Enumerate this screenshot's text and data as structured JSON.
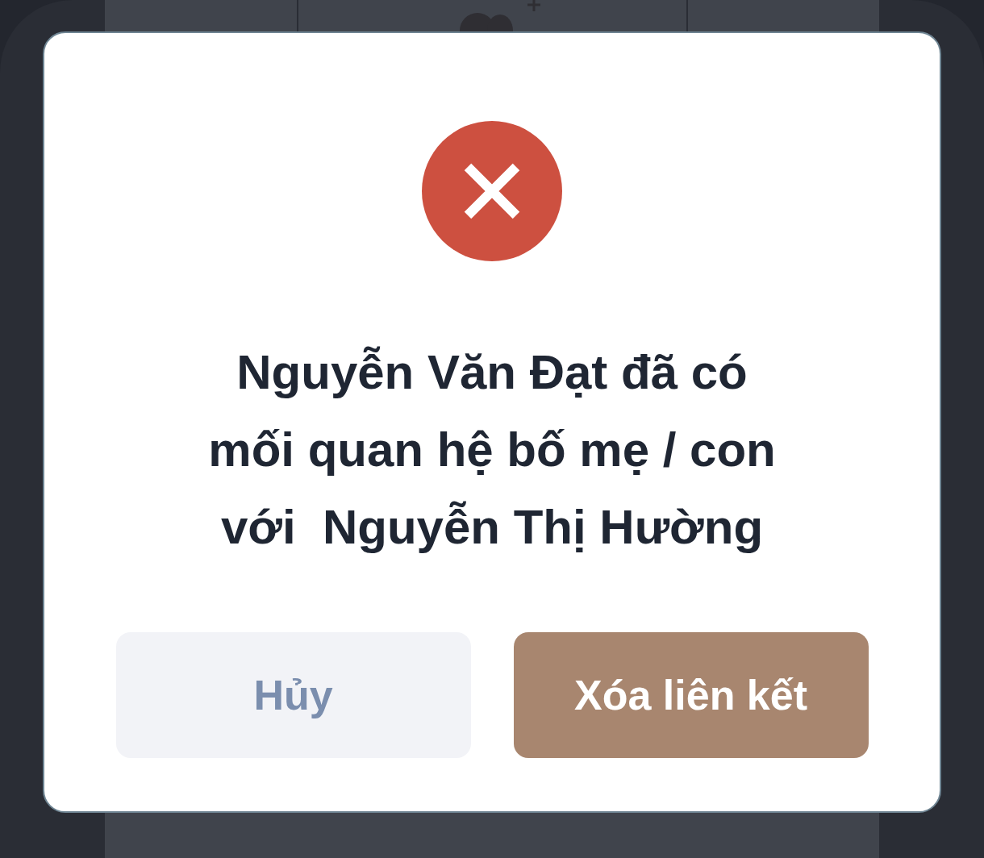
{
  "dialog": {
    "message_lines": [
      "Nguyễn Văn Đạt đã có",
      "mối quan hệ bố mẹ / con",
      "với  Nguyễn Thị Hường"
    ],
    "buttons": [
      {
        "label": "Hủy",
        "kind": "secondary"
      },
      {
        "label": "Xóa liên kết",
        "kind": "primary"
      }
    ]
  }
}
